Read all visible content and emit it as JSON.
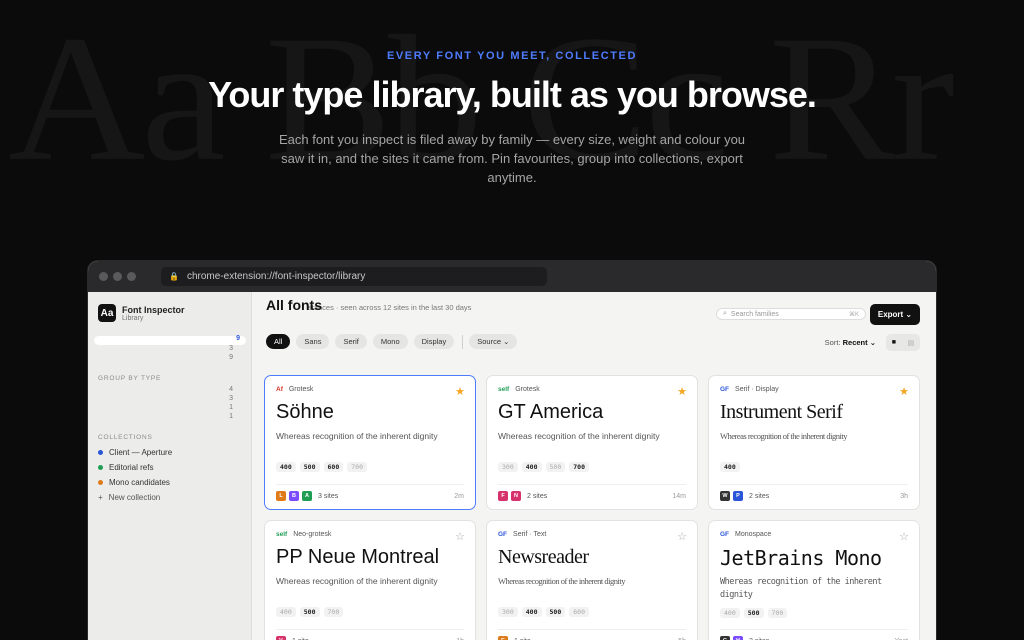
{
  "background_letters": "Aa Bb Cc Rr",
  "hero": {
    "eyebrow": "EVERY FONT YOU MEET, COLLECTED",
    "headline": "Your type library, built as you browse.",
    "subtitle": "Each font you inspect is filed away by family — every size, weight and colour you saw it in, and the sites it came from. Pin favourites, group into collections, export anytime."
  },
  "browser": {
    "url": "chrome-extension://font-inspector/library"
  },
  "sidebar": {
    "brand_logo": "Aa",
    "brand_name": "Font Inspector",
    "brand_sub": "Library",
    "nav_counts": [
      "9",
      "3",
      "9"
    ],
    "group_label": "GROUP BY TYPE",
    "group_counts": [
      "4",
      "3",
      "1",
      "1"
    ],
    "collections_label": "COLLECTIONS",
    "collections": [
      {
        "label": "Client — Aperture",
        "color": "#2b55d9"
      },
      {
        "label": "Editorial refs",
        "color": "#1f9d55"
      },
      {
        "label": "Mono candidates",
        "color": "#e07b1a"
      }
    ],
    "new_collection": "New collection"
  },
  "main": {
    "title": "All fonts",
    "meta": "stances · seen across 12 sites in the last 30 days",
    "search_placeholder": "Search families",
    "search_shortcut": "⌘K",
    "export_label": "Export ⌄",
    "filters": [
      "All",
      "Sans",
      "Serif",
      "Mono",
      "Display"
    ],
    "source_label": "Source ⌄",
    "sort_label": "Sort:",
    "sort_value": "Recent ⌄"
  },
  "cards": [
    {
      "src": "Af",
      "src_color": "#d93025",
      "category": "Grotesk",
      "name": "Söhne",
      "style": "sans",
      "sample": "Whereas recognition of the inherent dignity",
      "weights": [
        [
          "400",
          true
        ],
        [
          "500",
          true
        ],
        [
          "600",
          true
        ],
        [
          "700",
          false
        ]
      ],
      "favicons": [
        [
          "L",
          "#e07b1a"
        ],
        [
          "B",
          "#7c4dff"
        ],
        [
          "A",
          "#1f9d55"
        ]
      ],
      "sites": "3 sites",
      "ago": "2m",
      "starred": true,
      "selected": true
    },
    {
      "src": "self",
      "src_color": "#1f9d55",
      "category": "Grotesk",
      "name": "GT America",
      "style": "sans",
      "sample": "Whereas recognition of the inherent dignity",
      "weights": [
        [
          "300",
          false
        ],
        [
          "400",
          true
        ],
        [
          "500",
          false
        ],
        [
          "700",
          true
        ]
      ],
      "favicons": [
        [
          "F",
          "#d6336c"
        ],
        [
          "N",
          "#d6336c"
        ]
      ],
      "sites": "2 sites",
      "ago": "14m",
      "starred": true,
      "selected": false
    },
    {
      "src": "GF",
      "src_color": "#2b55d9",
      "category": "Serif · Display",
      "name": "Instrument Serif",
      "style": "serif",
      "sample": "Whereas recognition of the inherent dignity",
      "weights": [
        [
          "400",
          true
        ]
      ],
      "favicons": [
        [
          "W",
          "#333333"
        ],
        [
          "P",
          "#2b55d9"
        ]
      ],
      "sites": "2 sites",
      "ago": "3h",
      "starred": true,
      "selected": false
    },
    {
      "src": "self",
      "src_color": "#1f9d55",
      "category": "Neo-grotesk",
      "name": "PP Neue Montreal",
      "style": "sans",
      "sample": "Whereas recognition of the inherent dignity",
      "weights": [
        [
          "400",
          false
        ],
        [
          "500",
          true
        ],
        [
          "700",
          false
        ]
      ],
      "favicons": [
        [
          "V",
          "#d6336c"
        ]
      ],
      "sites": "1 site",
      "ago": "1h",
      "starred": false,
      "selected": false
    },
    {
      "src": "GF",
      "src_color": "#2b55d9",
      "category": "Serif · Text",
      "name": "Newsreader",
      "style": "serif",
      "sample": "Whereas recognition of the inherent dignity",
      "weights": [
        [
          "300",
          false
        ],
        [
          "400",
          true
        ],
        [
          "500",
          true
        ],
        [
          "600",
          false
        ]
      ],
      "favicons": [
        [
          "E",
          "#e07b1a"
        ]
      ],
      "sites": "1 site",
      "ago": "5h",
      "starred": false,
      "selected": false
    },
    {
      "src": "GF",
      "src_color": "#2b55d9",
      "category": "Monospace",
      "name": "JetBrains Mono",
      "style": "mono",
      "sample": "Whereas recognition of the inherent dignity",
      "weights": [
        [
          "400",
          false
        ],
        [
          "500",
          true
        ],
        [
          "700",
          false
        ]
      ],
      "favicons": [
        [
          "G",
          "#333333"
        ],
        [
          "H",
          "#7c4dff"
        ]
      ],
      "sites": "2 sites",
      "ago": "Yest",
      "starred": false,
      "selected": false
    }
  ]
}
